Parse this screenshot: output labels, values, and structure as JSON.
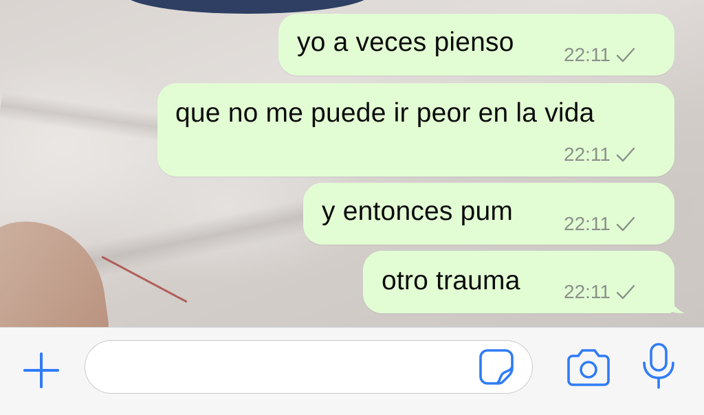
{
  "messages": [
    {
      "text": "yo a veces pienso",
      "time": "22:11",
      "status_icon": "single-check-icon"
    },
    {
      "text": "que no me puede ir peor en la vida",
      "time": "22:11",
      "status_icon": "single-check-icon"
    },
    {
      "text": "y entonces pum",
      "time": "22:11",
      "status_icon": "single-check-icon"
    },
    {
      "text": "otro trauma",
      "time": "22:11",
      "status_icon": "single-check-icon"
    }
  ],
  "input_bar": {
    "message_placeholder": "",
    "icons": {
      "attach": "plus-icon",
      "sticker": "sticker-icon",
      "camera": "camera-icon",
      "microphone": "microphone-icon"
    }
  },
  "colors": {
    "outgoing_bubble": "#e2fdd4",
    "accent_blue": "#2f7cf6",
    "meta_grey": "#8a9189",
    "input_bar_bg": "#f6f6f6"
  }
}
